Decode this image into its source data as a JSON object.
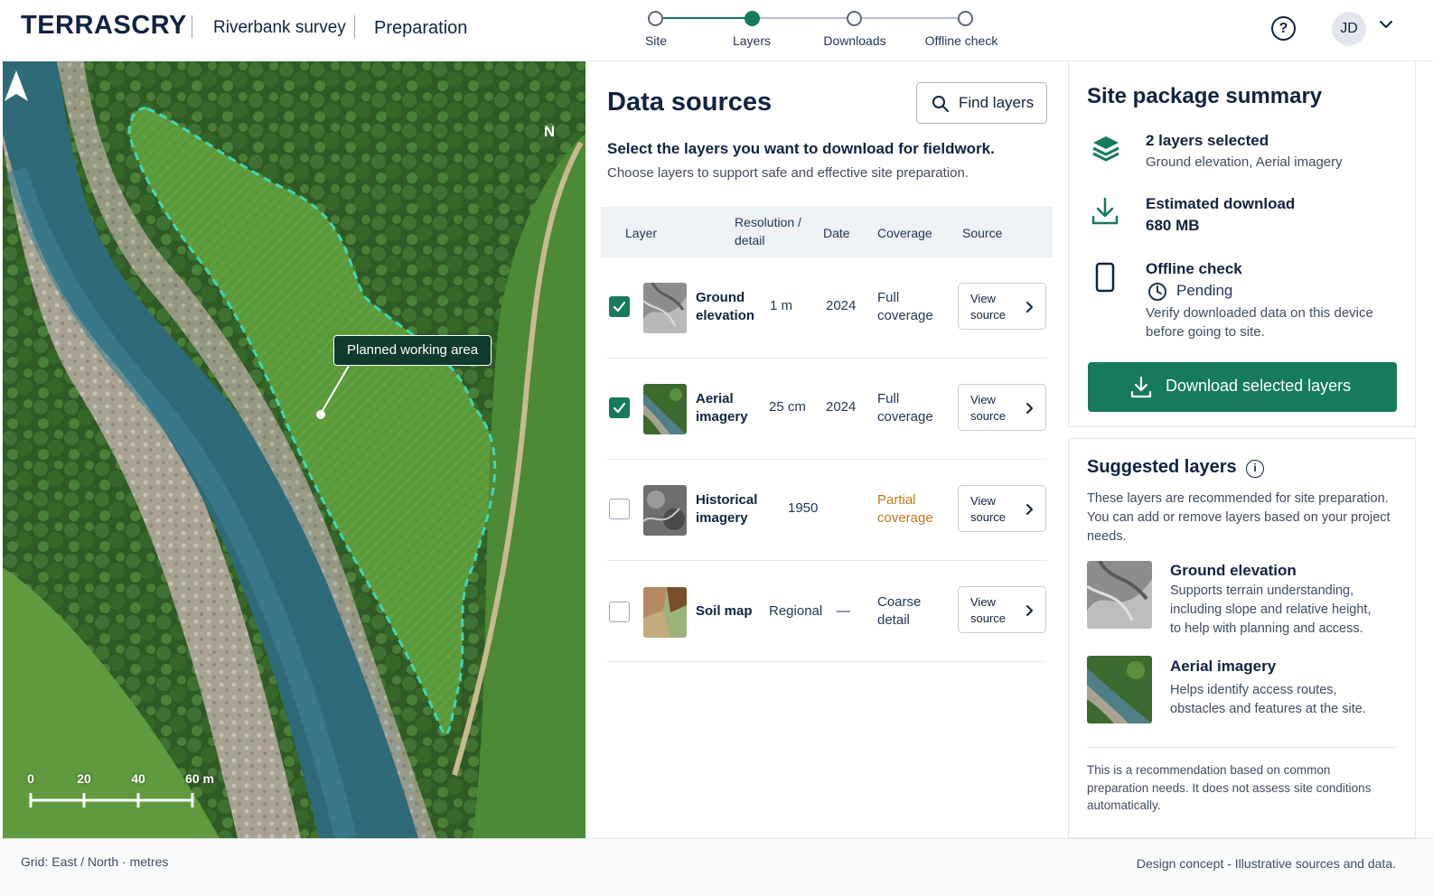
{
  "header": {
    "brand": "TERRASCRY",
    "breadcrumbs": [
      "Riverbank survey",
      "Preparation"
    ],
    "steps": [
      {
        "label": "Site",
        "state": "done"
      },
      {
        "label": "Layers",
        "state": "current"
      },
      {
        "label": "Downloads",
        "state": "todo"
      },
      {
        "label": "Offline check",
        "state": "todo"
      }
    ],
    "help_glyph": "?",
    "user_initials": "JD"
  },
  "map": {
    "compass_label": "N",
    "area_label": "Planned working area",
    "scale_ticks": [
      "0",
      "20",
      "40",
      "60 m"
    ]
  },
  "data_sources": {
    "title": "Data sources",
    "find_button": "Find layers",
    "subtitle": "Select the layers you want to download for fieldwork.",
    "description": "Choose layers to support safe and effective site preparation.",
    "columns": {
      "layer": "Layer",
      "resolution_1": "Resolution /",
      "resolution_2": "detail",
      "date": "Date",
      "coverage": "Coverage",
      "source": "Source"
    },
    "rows": [
      {
        "name_1": "Ground",
        "name_2": "elevation",
        "resolution": "1 m",
        "date": "2024",
        "coverage_1": "Full",
        "coverage_2": "coverage",
        "checked": true,
        "source_1": "View",
        "source_2": "source"
      },
      {
        "name_1": "Aerial",
        "name_2": "imagery",
        "resolution": "25 cm",
        "date": "2024",
        "coverage_1": "Full",
        "coverage_2": "coverage",
        "checked": true,
        "source_1": "View",
        "source_2": "source"
      },
      {
        "name_1": "Historical",
        "name_2": "imagery",
        "resolution": "1950",
        "date": "",
        "coverage_1": "Partial",
        "coverage_2": "coverage",
        "checked": false,
        "source_1": "View",
        "source_2": "source"
      },
      {
        "name_1": "Soil map",
        "name_2": "",
        "resolution": "Regional",
        "date": "—",
        "coverage_1": "Coarse",
        "coverage_2": "detail",
        "checked": false,
        "source_1": "View",
        "source_2": "source"
      }
    ]
  },
  "summary": {
    "title": "Site package summary",
    "layers_heading": "2 layers selected",
    "layers_detail": "Ground elevation, Aerial imagery",
    "download_heading": "Estimated download",
    "download_size": "680 MB",
    "offline_heading": "Offline check",
    "offline_status": "Pending",
    "offline_detail_1": "Verify downloaded data on this device",
    "offline_detail_2": "before going to site.",
    "download_button": "Download selected layers"
  },
  "suggested": {
    "title": "Suggested layers",
    "info_glyph": "i",
    "text_1": "These layers are recommended for site preparation.",
    "text_2": "You can add or remove layers based on your project",
    "text_3": "needs.",
    "items": [
      {
        "name": "Ground elevation",
        "d1": "Supports terrain understanding,",
        "d2": "including slope and relative height,",
        "d3": "to help with planning and access."
      },
      {
        "name": "Aerial imagery",
        "d1": "Helps identify access routes,",
        "d2": "obstacles and features at the site.",
        "d3": ""
      }
    ],
    "note_1": "This is a recommendation based on common",
    "note_2": "preparation needs. It does not assess site conditions",
    "note_3": "automatically."
  },
  "footer": {
    "left": "Grid:  East / North · metres",
    "right": "Design concept - Illustrative sources and data."
  },
  "colors": {
    "accent": "#167a5e",
    "navy": "#0f2342",
    "partial": "#c27a17",
    "area_outline": "#3fd7b4"
  }
}
